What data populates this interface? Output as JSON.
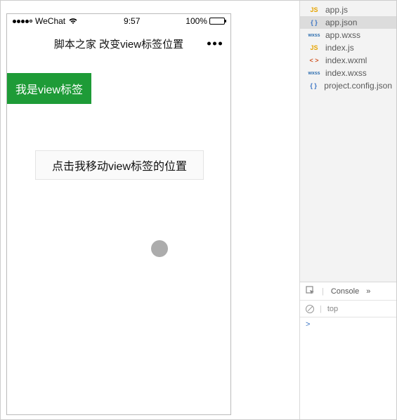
{
  "status": {
    "carrier": "WeChat",
    "time": "9:57",
    "battery": "100%"
  },
  "nav": {
    "title": "脚本之家 改变view标签位置"
  },
  "viewport": {
    "green_label": "我是view标签",
    "button_label": "点击我移动view标签的位置"
  },
  "files": [
    {
      "icon": "js",
      "name": "app.js",
      "selected": false
    },
    {
      "icon": "json",
      "name": "app.json",
      "selected": true
    },
    {
      "icon": "wxss",
      "name": "app.wxss",
      "selected": false
    },
    {
      "icon": "js",
      "name": "index.js",
      "selected": false
    },
    {
      "icon": "wxml",
      "name": "index.wxml",
      "selected": false
    },
    {
      "icon": "wxss",
      "name": "index.wxss",
      "selected": false
    },
    {
      "icon": "json",
      "name": "project.config.json",
      "selected": false
    }
  ],
  "console": {
    "tab_label": "Console",
    "more": "»",
    "scope": "top",
    "prompt": ">"
  },
  "icon_text": {
    "js": "JS",
    "json": "{ }",
    "wxss": "wxss",
    "wxml": "< >"
  }
}
